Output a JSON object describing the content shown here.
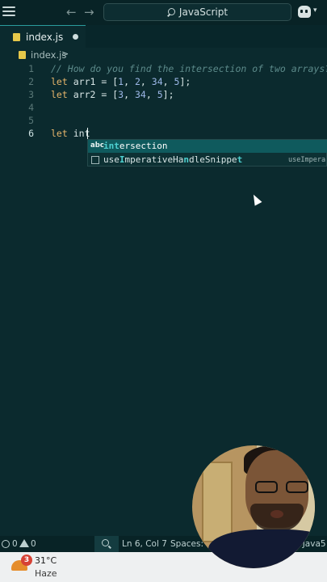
{
  "titlebar": {
    "search_text": "JavaScript"
  },
  "tab": {
    "label": "index.js"
  },
  "breadcrumb": {
    "file": "index.js",
    "separator": ">"
  },
  "editor": {
    "line_numbers": [
      "1",
      "2",
      "3",
      "4",
      "5",
      "6"
    ],
    "lines": [
      "// How do you find the intersection of two arrays?",
      "let arr1 = [1, 2, 34, 5];",
      "let arr2 = [3, 34, 5];",
      "",
      "",
      "let int"
    ]
  },
  "suggest": {
    "items": [
      {
        "icon": "abc",
        "label": "intersection",
        "detail": ""
      },
      {
        "icon": "snippet",
        "label": "useImperativeHandleSnippet",
        "detail": "useImpera"
      }
    ]
  },
  "statusbar": {
    "errors": "0",
    "warnings": "0",
    "position": "Ln 6, Col 7",
    "spaces": "Spaces: 4",
    "language": "el Java5"
  },
  "taskbar": {
    "badge": "3",
    "temperature": "31°C",
    "condition": "Haze"
  },
  "colors": {
    "editor_bg": "#0b2a2e",
    "keyword": "#e4b46a",
    "number": "#9db8e8",
    "comment": "#5c8a8a",
    "suggest_selected": "#0f5a5d",
    "match_highlight": "#4ed1d1"
  }
}
